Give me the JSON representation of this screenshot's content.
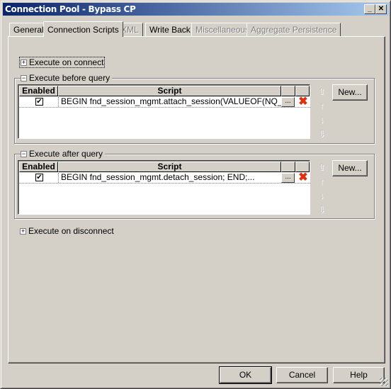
{
  "window": {
    "title": "Connection Pool - Bypass CP",
    "controls": {
      "minimize": "_",
      "maximize": "□",
      "close": "✕"
    }
  },
  "tabs": [
    {
      "label": "General",
      "state": "normal"
    },
    {
      "label": "Connection Scripts",
      "state": "active"
    },
    {
      "label": "XML",
      "state": "disabled"
    },
    {
      "label": "Write Back",
      "state": "normal"
    },
    {
      "label": "Miscellaneous",
      "state": "disabled"
    },
    {
      "label": "Aggregate Persistence",
      "state": "disabled"
    }
  ],
  "sections": {
    "on_connect": {
      "label": "Execute on connect",
      "expander": "+"
    },
    "before_query": {
      "label": "Execute before query",
      "expander": "−",
      "columns": [
        "Enabled",
        "Script"
      ],
      "rows": [
        {
          "enabled": "✔",
          "script": "BEGIN fnd_session_mgmt.attach_session(VALUEOF(NQ_SES...",
          "edit": "...",
          "delete_icon": "✖"
        }
      ],
      "new_label": "New..."
    },
    "after_query": {
      "label": "Execute after query",
      "expander": "−",
      "columns": [
        "Enabled",
        "Script"
      ],
      "rows": [
        {
          "enabled": "✔",
          "script": "BEGIN fnd_session_mgmt.detach_session; END;...",
          "edit": "...",
          "delete_icon": "✖"
        }
      ],
      "new_label": "New..."
    },
    "on_disconnect": {
      "label": "Execute on disconnect",
      "expander": "+"
    }
  },
  "arrows": {
    "top": "⇧",
    "up": "↑",
    "down": "↓",
    "bottom": "⇩"
  },
  "footer": {
    "ok": "OK",
    "cancel": "Cancel",
    "help": "Help"
  }
}
